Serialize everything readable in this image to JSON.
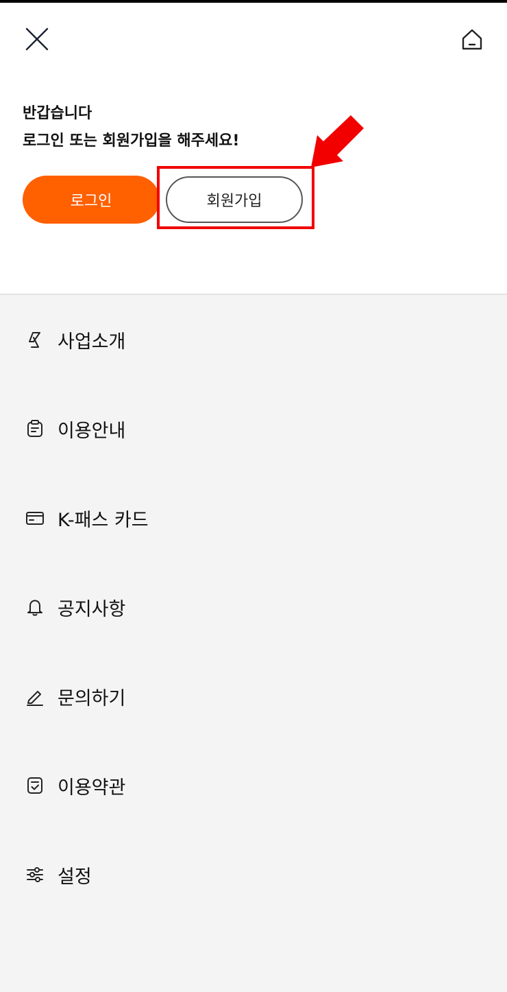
{
  "header": {
    "close_icon": "close-icon",
    "home_icon": "home-icon"
  },
  "greeting": {
    "line1": "반갑습니다",
    "line2": "로그인 또는 회원가입을 해주세요!"
  },
  "buttons": {
    "login_label": "로그인",
    "signup_label": "회원가입"
  },
  "colors": {
    "accent": "#ff6000",
    "highlight": "#f20000"
  },
  "menu": {
    "items": [
      {
        "label": "사업소개",
        "icon": "k-logo-icon"
      },
      {
        "label": "이용안내",
        "icon": "clipboard-icon"
      },
      {
        "label": "K-패스 카드",
        "icon": "card-icon"
      },
      {
        "label": "공지사항",
        "icon": "bell-icon"
      },
      {
        "label": "문의하기",
        "icon": "pencil-icon"
      },
      {
        "label": "이용약관",
        "icon": "document-check-icon"
      },
      {
        "label": "설정",
        "icon": "sliders-icon"
      }
    ]
  }
}
